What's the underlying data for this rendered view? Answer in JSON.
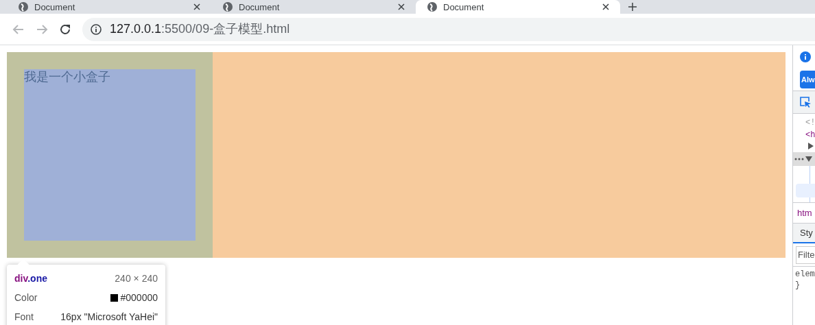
{
  "tabs": [
    {
      "title": "Document",
      "selected": false
    },
    {
      "title": "Document",
      "selected": false
    },
    {
      "title": "Document",
      "selected": true
    }
  ],
  "address": {
    "host": "127.0.0.1",
    "path": ":5500/09-盒子模型.html"
  },
  "page": {
    "box_text": "我是一个小盒子"
  },
  "tooltip": {
    "tag": "div",
    "class_name": ".one",
    "size": "240 × 240",
    "rows": [
      {
        "kind": "color",
        "label": "Color",
        "value": "#000000",
        "color": "#000000"
      },
      {
        "kind": "text",
        "label": "Font",
        "value": "16px \"Microsoft YaHei\""
      }
    ]
  },
  "devtools": {
    "button": "Alw",
    "lines": [
      "<!",
      "<h"
    ],
    "breadcrumb": "htm",
    "tab": "Sty",
    "filter_placeholder": "Filte",
    "rule_lines": [
      "elem",
      "}"
    ]
  }
}
